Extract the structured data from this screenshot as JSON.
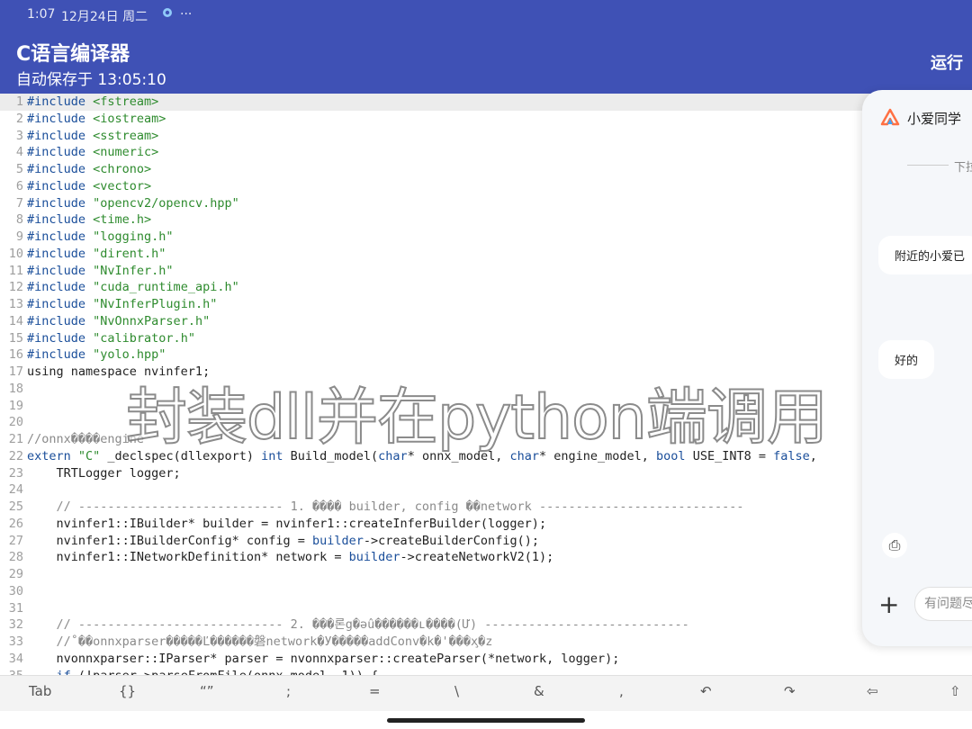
{
  "status": {
    "time": "1:07",
    "date": "12月24日 周二",
    "more": "···"
  },
  "app": {
    "title": "C语言编译器",
    "autosave": "自动保存于 13:05:10",
    "run_label": "运行"
  },
  "editor": {
    "lines": [
      [
        [
          "kw",
          "#include "
        ],
        [
          "str",
          "<fstream>"
        ]
      ],
      [
        [
          "kw",
          "#include "
        ],
        [
          "str",
          "<iostream>"
        ]
      ],
      [
        [
          "kw",
          "#include "
        ],
        [
          "str",
          "<sstream>"
        ]
      ],
      [
        [
          "kw",
          "#include "
        ],
        [
          "str",
          "<numeric>"
        ]
      ],
      [
        [
          "kw",
          "#include "
        ],
        [
          "str",
          "<chrono>"
        ]
      ],
      [
        [
          "kw",
          "#include "
        ],
        [
          "str",
          "<vector>"
        ]
      ],
      [
        [
          "kw",
          "#include "
        ],
        [
          "str",
          "\"opencv2/opencv.hpp\""
        ]
      ],
      [
        [
          "kw",
          "#include "
        ],
        [
          "str",
          "<time.h>"
        ]
      ],
      [
        [
          "kw",
          "#include "
        ],
        [
          "str",
          "\"logging.h\""
        ]
      ],
      [
        [
          "kw",
          "#include "
        ],
        [
          "str",
          "\"dirent.h\""
        ]
      ],
      [
        [
          "kw",
          "#include "
        ],
        [
          "str",
          "\"NvInfer.h\""
        ]
      ],
      [
        [
          "kw",
          "#include "
        ],
        [
          "str",
          "\"cuda_runtime_api.h\""
        ]
      ],
      [
        [
          "kw",
          "#include "
        ],
        [
          "str",
          "\"NvInferPlugin.h\""
        ]
      ],
      [
        [
          "kw",
          "#include "
        ],
        [
          "str",
          "\"NvOnnxParser.h\""
        ]
      ],
      [
        [
          "kw",
          "#include "
        ],
        [
          "str",
          "\"calibrator.h\""
        ]
      ],
      [
        [
          "kw",
          "#include "
        ],
        [
          "str",
          "\"yolo.hpp\""
        ]
      ],
      [
        [
          "",
          "using namespace nvinfer1;"
        ]
      ],
      [],
      [],
      [],
      [
        [
          "com",
          "//onnx����engine"
        ]
      ],
      [
        [
          "kw",
          "extern "
        ],
        [
          "str",
          "\"C\""
        ],
        [
          "",
          " _declspec(dllexport) "
        ],
        [
          "kw",
          "int"
        ],
        [
          "",
          " Build_model("
        ],
        [
          "kw",
          "char"
        ],
        [
          "",
          "* onnx_model, "
        ],
        [
          "kw",
          "char"
        ],
        [
          "",
          "* engine_model, "
        ],
        [
          "kw",
          "bool"
        ],
        [
          "",
          " USE_INT8 = "
        ],
        [
          "kw",
          "false"
        ],
        [
          "",
          ","
        ]
      ],
      [
        [
          "",
          "    TRTLogger logger;"
        ]
      ],
      [],
      [
        [
          "com",
          "    // ---------------------------- 1. ���� builder, config ��network ----------------------------"
        ]
      ],
      [
        [
          "",
          "    nvinfer1::IBuilder* builder = nvinfer1::createInferBuilder(logger);"
        ]
      ],
      [
        [
          "",
          "    nvinfer1::IBuilderConfig* config = "
        ],
        [
          "kw",
          "builder"
        ],
        [
          "",
          "->createBuilderConfig();"
        ]
      ],
      [
        [
          "",
          "    nvinfer1::INetworkDefinition* network = "
        ],
        [
          "kw",
          "builder"
        ],
        [
          "",
          "->createNetworkV2(1);"
        ]
      ],
      [],
      [],
      [],
      [
        [
          "com",
          "    // ---------------------------- 2. ���론g�ǝû������ʟ����(Ư) ----------------------------"
        ]
      ],
      [
        [
          "com",
          "    //˚��onnxparser�����Ľ������磐network�У�����addConv�k�'���x̧�z"
        ]
      ],
      [
        [
          "",
          "    nvonnxparser::IParser* parser = nvonnxparser::createParser(*network, logger);"
        ]
      ],
      [
        [
          "",
          "    "
        ],
        [
          "kw",
          "if"
        ],
        [
          "",
          " (!parser->parseFromFile(onnx_model, 1)) {"
        ]
      ]
    ]
  },
  "overlay": {
    "watermark": "封装dll并在python端调用"
  },
  "assistant": {
    "name": "小爱同学",
    "pull_hint": "下拉",
    "message1": "附近的小爱已",
    "message2": "好的",
    "input_placeholder": "有问题尽"
  },
  "toolbar": {
    "keys": [
      "Tab",
      "{}",
      "“”",
      ";",
      "=",
      "\\",
      "&",
      ",",
      "↶",
      "↷",
      "⇦",
      "⇧"
    ]
  },
  "colors": {
    "accent": "#3f51b5",
    "keyword": "#1a4e9a",
    "string": "#2e8b2e",
    "comment": "#8a8a8a"
  }
}
